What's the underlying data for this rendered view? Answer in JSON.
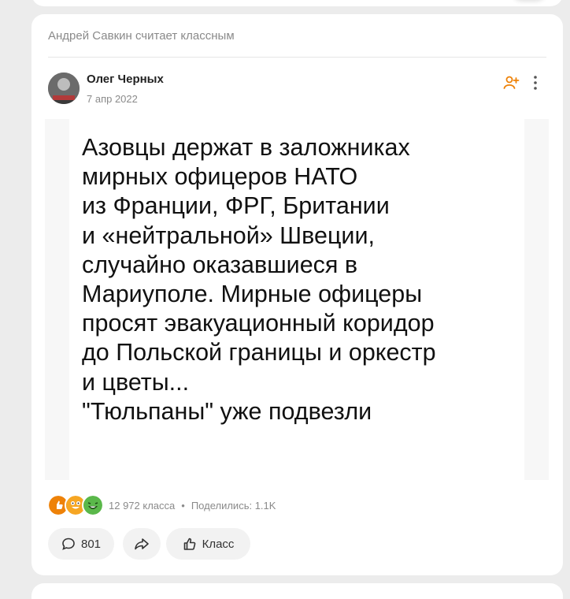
{
  "feed": {
    "notice": "Андрей Савкин считает классным",
    "post": {
      "author": "Олег Черных",
      "date": "7 апр 2022",
      "image_text": "Азовцы держат в заложниках\nмирных офицеров НАТО\nиз Франции, ФРГ, Британии\nи «нейтральной» Швеции,\nслучайно оказавшиеся в\nМариуполе. Мирные офицеры\nпросят эвакуационный коридор\nдо Польской границы и оркестр\nи цветы...\n\"Тюльпаны\" уже подвезли",
      "reactions": {
        "count": "12 972 класса",
        "separator": "•",
        "shares": "Поделились: 1.1K"
      },
      "actions": {
        "comments": "801",
        "like_label": "Класс"
      }
    }
  },
  "colors": {
    "accent": "#ee8208",
    "background": "#ececec"
  },
  "icons": [
    "add-friend-icon",
    "more-icon",
    "comment-icon",
    "share-icon",
    "like-icon"
  ]
}
